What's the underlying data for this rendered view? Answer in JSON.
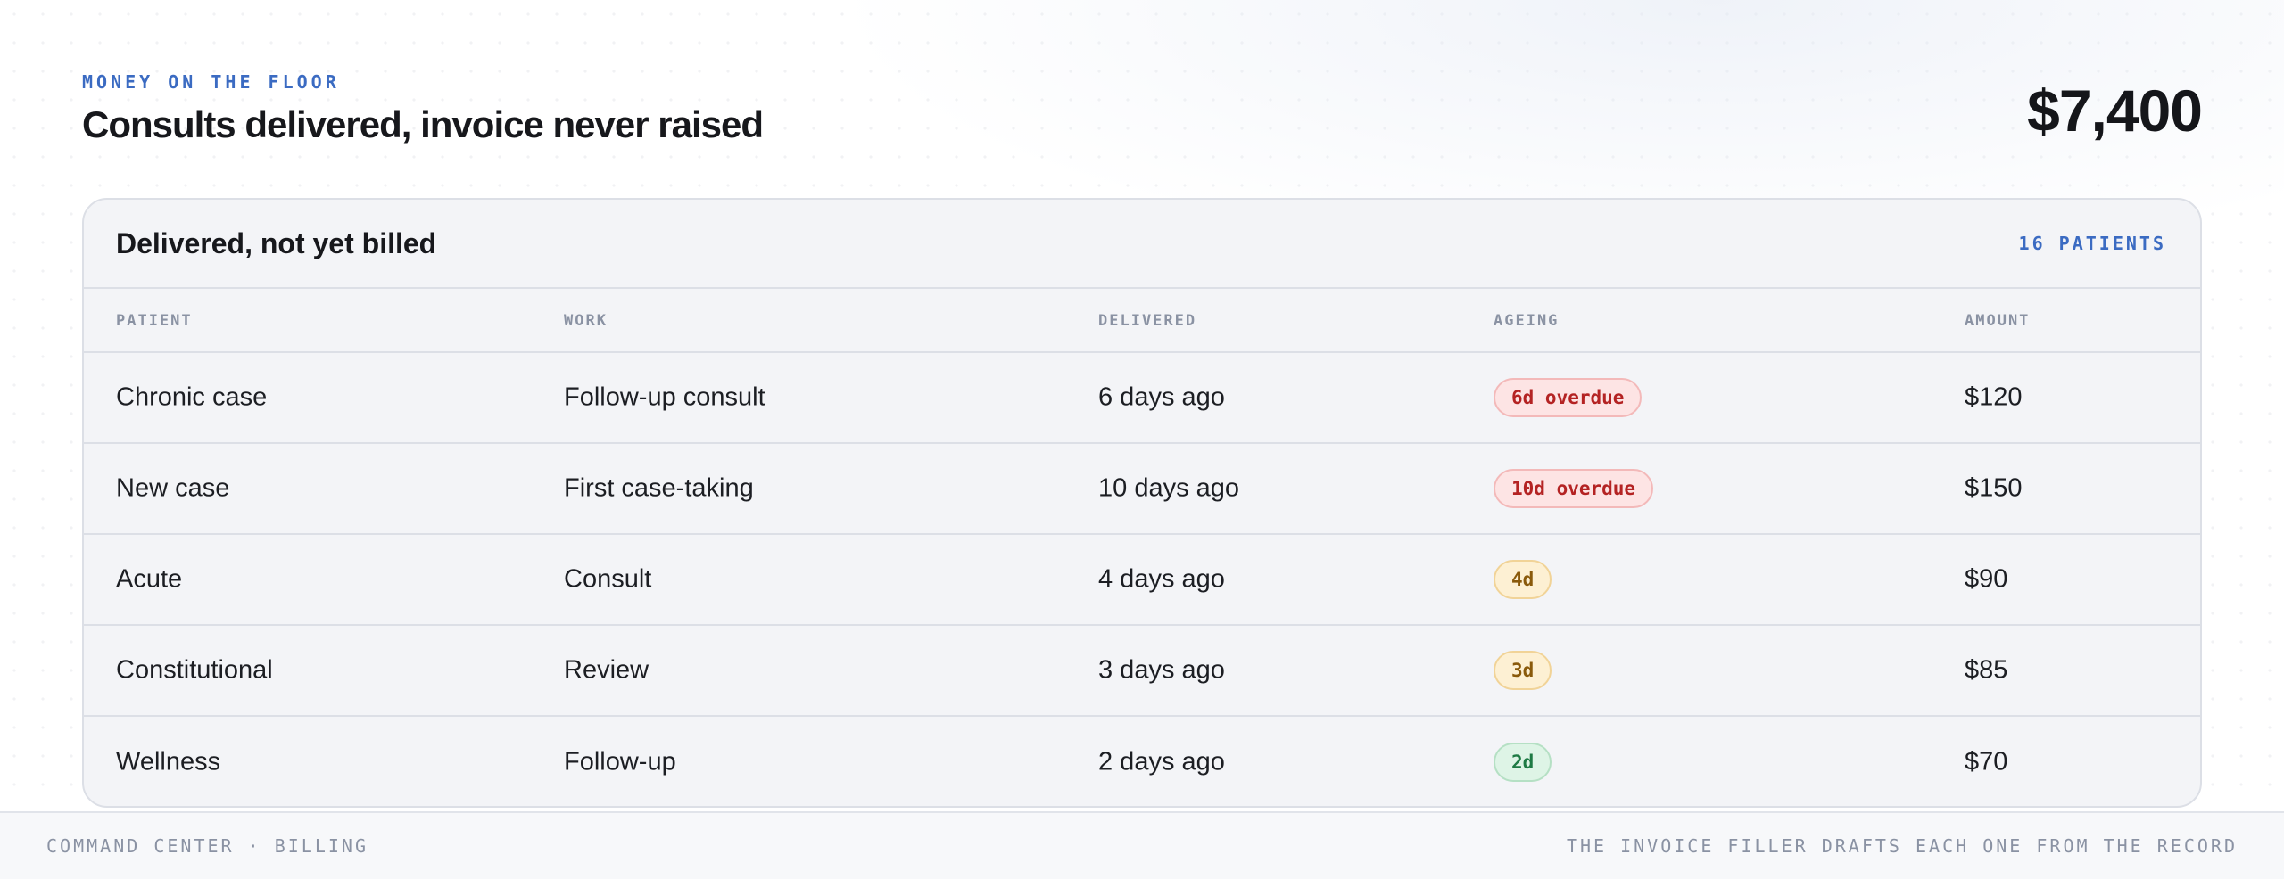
{
  "header": {
    "eyebrow": "MONEY ON THE FLOOR",
    "title": "Consults delivered, invoice never raised",
    "total": "$7,400"
  },
  "card": {
    "title": "Delivered, not yet billed",
    "count": "16 PATIENTS",
    "columns": [
      "PATIENT",
      "WORK",
      "DELIVERED",
      "AGEING",
      "AMOUNT"
    ],
    "rows": [
      {
        "patient": "Chronic case",
        "work": "Follow-up consult",
        "delivered": "6 days ago",
        "ageing": "6d overdue",
        "ageing_status": "overdue",
        "amount": "$120"
      },
      {
        "patient": "New case",
        "work": "First case-taking",
        "delivered": "10 days ago",
        "ageing": "10d overdue",
        "ageing_status": "overdue",
        "amount": "$150"
      },
      {
        "patient": "Acute",
        "work": "Consult",
        "delivered": "4 days ago",
        "ageing": "4d",
        "ageing_status": "warning",
        "amount": "$90"
      },
      {
        "patient": "Constitutional",
        "work": "Review",
        "delivered": "3 days ago",
        "ageing": "3d",
        "ageing_status": "warning",
        "amount": "$85"
      },
      {
        "patient": "Wellness",
        "work": "Follow-up",
        "delivered": "2 days ago",
        "ageing": "2d",
        "ageing_status": "ok",
        "amount": "$70"
      }
    ]
  },
  "footer": {
    "left": "COMMAND CENTER · BILLING",
    "right": "THE INVOICE FILLER DRAFTS EACH ONE FROM THE RECORD"
  },
  "colors": {
    "accent": "#3b6bc2",
    "overdue": "#b42323",
    "warning": "#8a5a0b",
    "ok": "#1e7a44"
  }
}
